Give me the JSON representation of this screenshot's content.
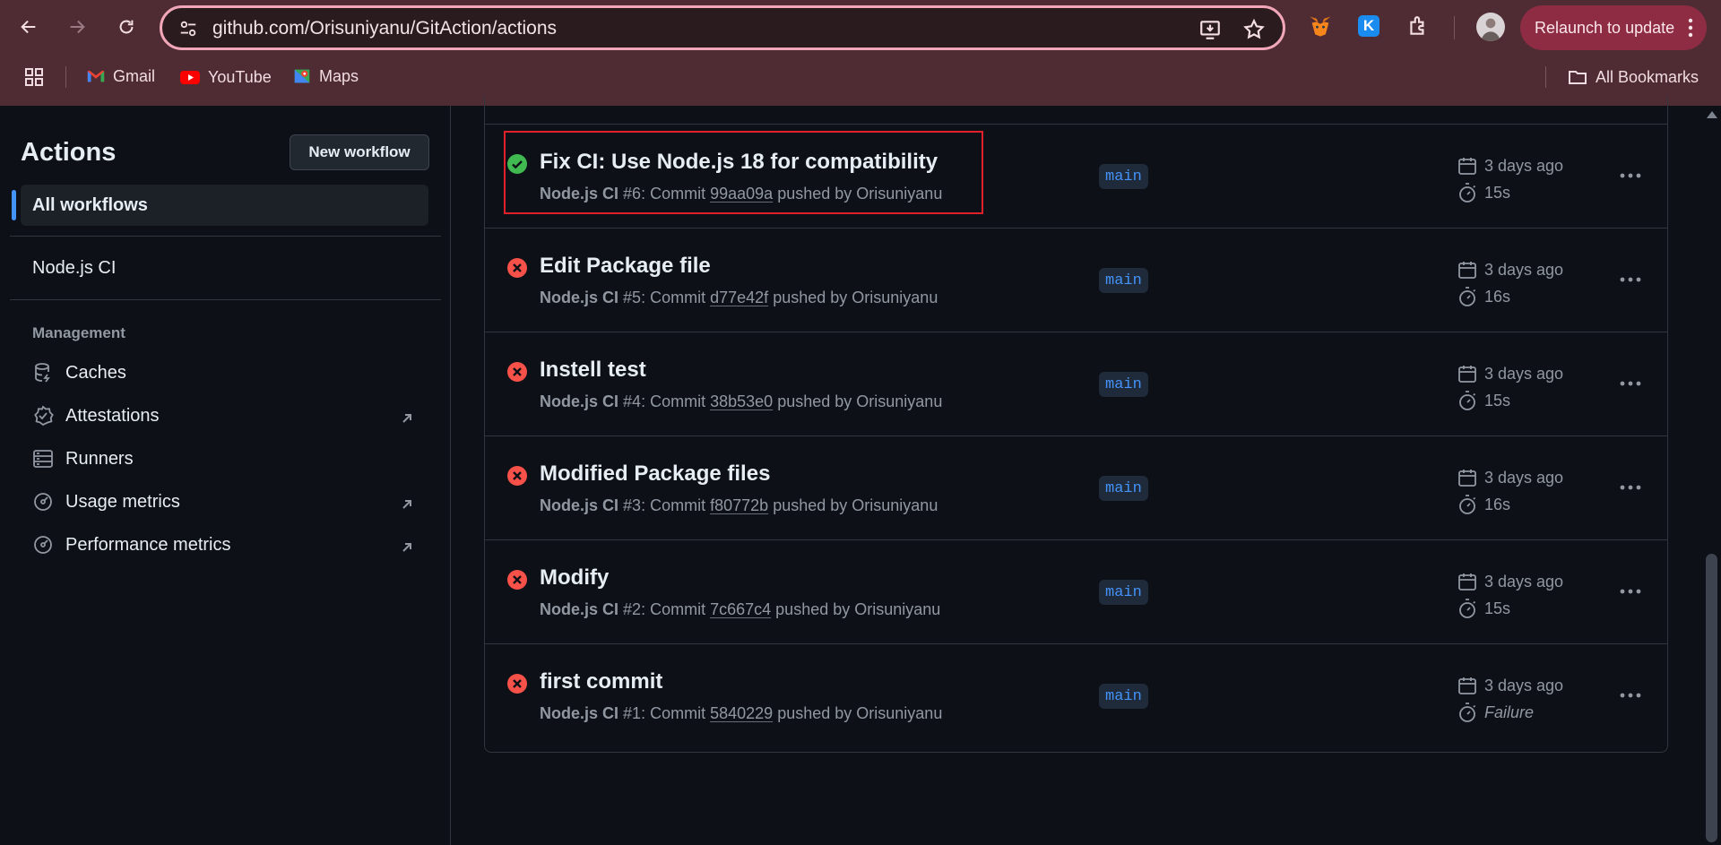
{
  "browser": {
    "url": "github.com/Orisuniyanu/GitAction/actions",
    "relaunch_label": "Relaunch to update",
    "bookmarks": [
      {
        "label": "Gmail",
        "icon": "gmail-icon"
      },
      {
        "label": "YouTube",
        "icon": "youtube-icon"
      },
      {
        "label": "Maps",
        "icon": "maps-icon"
      }
    ],
    "all_bookmarks_label": "All Bookmarks",
    "extension_k_label": "K"
  },
  "sidebar": {
    "title": "Actions",
    "new_workflow_label": "New workflow",
    "all_workflows_label": "All workflows",
    "workflow_label": "Node.js CI",
    "management_heading": "Management",
    "items": [
      {
        "label": "Caches",
        "icon": "database-icon",
        "external": false
      },
      {
        "label": "Attestations",
        "icon": "verified-icon",
        "external": true
      },
      {
        "label": "Runners",
        "icon": "server-icon",
        "external": false
      },
      {
        "label": "Usage metrics",
        "icon": "meter-icon",
        "external": true
      },
      {
        "label": "Performance metrics",
        "icon": "meter-icon",
        "external": true
      }
    ]
  },
  "runs": [
    {
      "title": "Fix CI: Use Node.js 18 for compatibility",
      "workflow": "Node.js CI",
      "number": "#6",
      "sha": "99aa09a",
      "author": "Orisuniyanu",
      "branch": "main",
      "when": "3 days ago",
      "duration": "15s",
      "status": "success"
    },
    {
      "title": "Edit Package file",
      "workflow": "Node.js CI",
      "number": "#5",
      "sha": "d77e42f",
      "author": "Orisuniyanu",
      "branch": "main",
      "when": "3 days ago",
      "duration": "16s",
      "status": "failure"
    },
    {
      "title": "Instell test",
      "workflow": "Node.js CI",
      "number": "#4",
      "sha": "38b53e0",
      "author": "Orisuniyanu",
      "branch": "main",
      "when": "3 days ago",
      "duration": "15s",
      "status": "failure"
    },
    {
      "title": "Modified Package files",
      "workflow": "Node.js CI",
      "number": "#3",
      "sha": "f80772b",
      "author": "Orisuniyanu",
      "branch": "main",
      "when": "3 days ago",
      "duration": "16s",
      "status": "failure"
    },
    {
      "title": "Modify",
      "workflow": "Node.js CI",
      "number": "#2",
      "sha": "7c667c4",
      "author": "Orisuniyanu",
      "branch": "main",
      "when": "3 days ago",
      "duration": "15s",
      "status": "failure"
    },
    {
      "title": "first commit",
      "workflow": "Node.js CI",
      "number": "#1",
      "sha": "5840229",
      "author": "Orisuniyanu",
      "branch": "main",
      "when": "3 days ago",
      "duration": "Failure",
      "status": "failure"
    }
  ],
  "text": {
    "commit_word": "Commit",
    "pushed_by": "pushed by"
  },
  "colors": {
    "success": "#3fb950",
    "failure": "#f85149",
    "accent": "#4493f8",
    "chrome": "#4f2c33"
  }
}
